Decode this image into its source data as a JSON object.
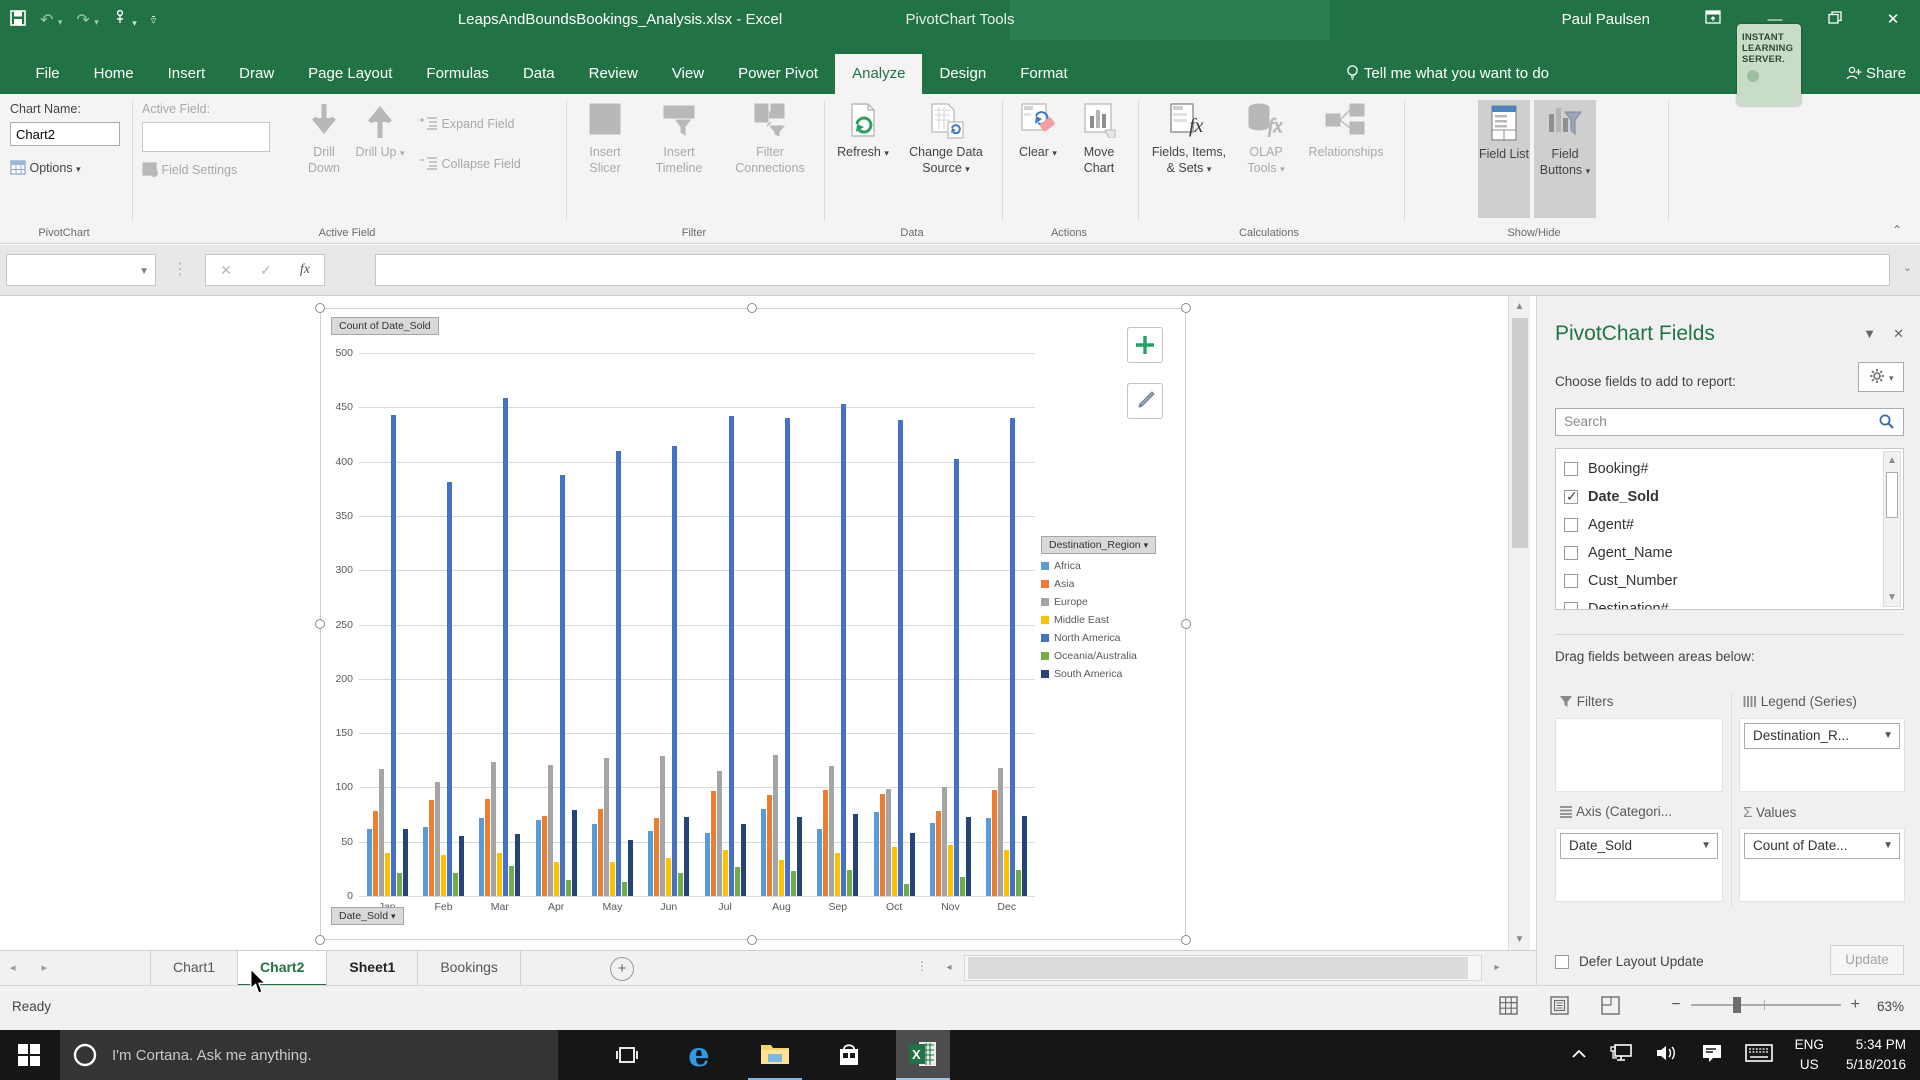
{
  "titlebar": {
    "title": "LeapsAndBoundsBookings_Analysis.xlsx - Excel",
    "context_label": "PivotChart Tools",
    "user": "Paul Paulsen"
  },
  "ribbon": {
    "tabs": [
      {
        "label": "File"
      },
      {
        "label": "Home"
      },
      {
        "label": "Insert"
      },
      {
        "label": "Draw"
      },
      {
        "label": "Page Layout"
      },
      {
        "label": "Formulas"
      },
      {
        "label": "Data"
      },
      {
        "label": "Review"
      },
      {
        "label": "View"
      },
      {
        "label": "Power Pivot"
      },
      {
        "label": "Analyze",
        "active": true
      },
      {
        "label": "Design"
      },
      {
        "label": "Format"
      }
    ],
    "tell_me": "Tell me what you want to do",
    "share_label": "Share",
    "badge_lines": [
      "INSTANT",
      "LEARNING",
      "SERVER."
    ],
    "groups": {
      "pivotchart": {
        "caption": "PivotChart",
        "chart_name_label": "Chart Name:",
        "chart_name_value": "Chart2",
        "options": "Options"
      },
      "active_field": {
        "caption": "Active Field",
        "label": "Active Field:",
        "field_settings": "Field Settings",
        "drill_down": "Drill Down",
        "drill_up": "Drill Up",
        "expand": "Expand Field",
        "collapse": "Collapse Field"
      },
      "filter": {
        "caption": "Filter",
        "insert_slicer": "Insert Slicer",
        "insert_timeline": "Insert Timeline",
        "filter_connections": "Filter Connections"
      },
      "data": {
        "caption": "Data",
        "refresh": "Refresh",
        "change_source": "Change Data Source"
      },
      "actions": {
        "caption": "Actions",
        "clear": "Clear",
        "move_chart": "Move Chart"
      },
      "calculations": {
        "caption": "Calculations",
        "fields_items": "Fields, Items, & Sets",
        "olap": "OLAP Tools",
        "relationships": "Relationships"
      },
      "show_hide": {
        "caption": "Show/Hide",
        "field_list": "Field List",
        "field_buttons": "Field Buttons"
      }
    }
  },
  "formula_bar": {
    "name_box_value": "",
    "formula_value": ""
  },
  "chart_data": {
    "type": "bar",
    "title": "",
    "categories": [
      "Jan",
      "Feb",
      "Mar",
      "Apr",
      "May",
      "Jun",
      "Jul",
      "Aug",
      "Sep",
      "Oct",
      "Nov",
      "Dec"
    ],
    "series": [
      {
        "name": "Africa",
        "color": "#5B9BD5",
        "values": [
          62,
          64,
          72,
          70,
          66,
          60,
          58,
          80,
          62,
          77,
          67,
          72
        ]
      },
      {
        "name": "Asia",
        "color": "#ED7D31",
        "values": [
          78,
          88,
          89,
          74,
          80,
          72,
          97,
          93,
          98,
          94,
          78,
          98
        ]
      },
      {
        "name": "Europe",
        "color": "#A5A5A5",
        "values": [
          117,
          105,
          123,
          121,
          127,
          129,
          115,
          130,
          120,
          99,
          100,
          118
        ]
      },
      {
        "name": "Middle East",
        "color": "#FFC000",
        "values": [
          40,
          38,
          40,
          31,
          31,
          35,
          42,
          33,
          40,
          45,
          47,
          42
        ]
      },
      {
        "name": "North America",
        "color": "#4472C4",
        "values": [
          443,
          381,
          459,
          388,
          410,
          414,
          442,
          440,
          453,
          438,
          402,
          440
        ]
      },
      {
        "name": "Oceania/Australia",
        "color": "#70AD47",
        "values": [
          21,
          21,
          28,
          15,
          13,
          21,
          27,
          23,
          24,
          11,
          18,
          24
        ]
      },
      {
        "name": "South America",
        "color": "#264478",
        "values": [
          62,
          55,
          57,
          79,
          52,
          73,
          66,
          73,
          76,
          58,
          73,
          74
        ]
      }
    ],
    "ylim": [
      0,
      500
    ],
    "ytick_step": 50,
    "grid": true,
    "legend_position": "right",
    "legend_title": "Destination_Region",
    "value_field_button": "Count of Date_Sold",
    "axis_field_button": "Date_Sold"
  },
  "fields_pane": {
    "title": "PivotChart Fields",
    "choose_label": "Choose fields to add to report:",
    "search_placeholder": "Search",
    "fields": [
      {
        "name": "Booking#",
        "checked": false
      },
      {
        "name": "Date_Sold",
        "checked": true
      },
      {
        "name": "Agent#",
        "checked": false
      },
      {
        "name": "Agent_Name",
        "checked": false
      },
      {
        "name": "Cust_Number",
        "checked": false
      },
      {
        "name": "Destination#",
        "checked": false
      }
    ],
    "drag_label": "Drag fields between areas below:",
    "areas": {
      "filters": {
        "label": "Filters",
        "items": []
      },
      "legend": {
        "label": "Legend (Series)",
        "items": [
          "Destination_R..."
        ]
      },
      "axis": {
        "label": "Axis (Categori...",
        "items": [
          "Date_Sold"
        ]
      },
      "values": {
        "label": "Values",
        "items": [
          "Count of Date..."
        ]
      }
    },
    "defer_label": "Defer Layout Update",
    "update_label": "Update"
  },
  "sheet_bar": {
    "tabs": [
      {
        "label": "Chart1"
      },
      {
        "label": "Chart2",
        "active": true
      },
      {
        "label": "Sheet1",
        "hovered": true
      },
      {
        "label": "Bookings"
      }
    ],
    "new_sheet": "+"
  },
  "status_bar": {
    "ready": "Ready",
    "zoom_level": "63%"
  },
  "taskbar": {
    "cortana_placeholder": "I'm Cortana. Ask me anything.",
    "tray": {
      "lang_line1": "ENG",
      "lang_line2": "US",
      "time": "5:34 PM",
      "date": "5/18/2016"
    }
  },
  "colors": {
    "excel_green": "#217346",
    "accent_blue": "#4472C4",
    "taskbar_underline": "#76b9ed"
  }
}
